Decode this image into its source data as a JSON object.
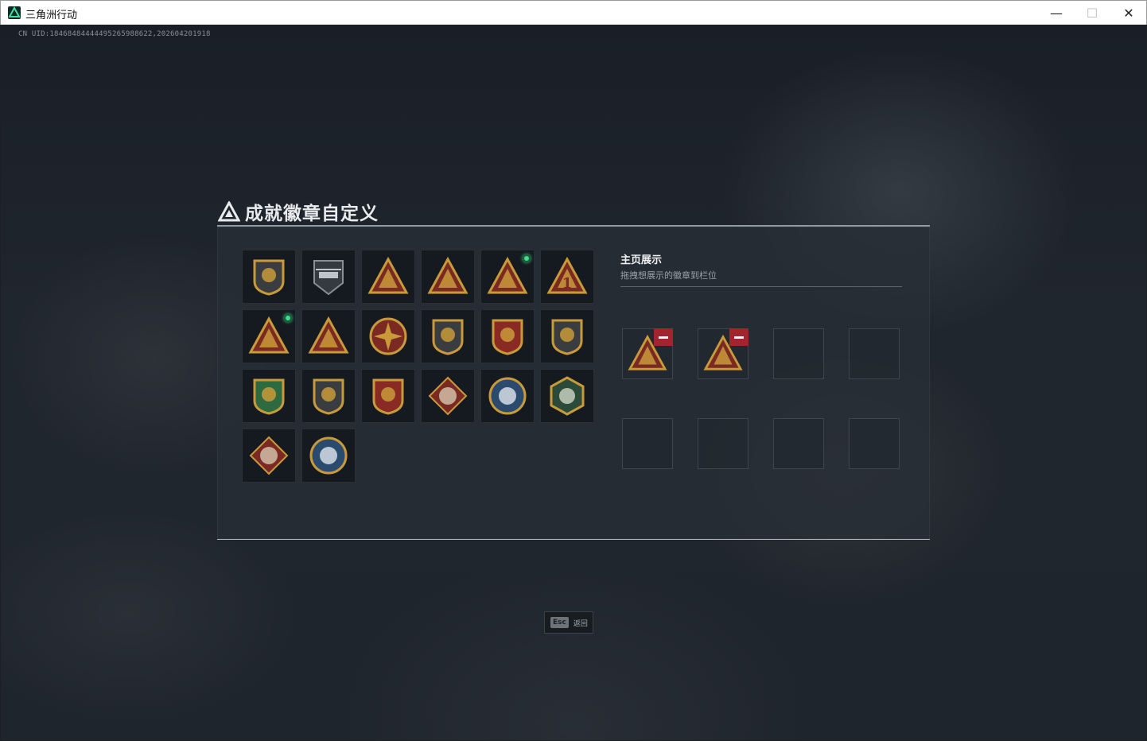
{
  "window": {
    "title": "三角洲行动",
    "minimize": "—",
    "maximize": "☐",
    "close": "✕"
  },
  "uid": "CN UID:18468484444495265988622,202604201918",
  "panel": {
    "title": "成就徽章自定义"
  },
  "showcase": {
    "title": "主页展示",
    "subtitle": "拖拽想展示的徽章到栏位"
  },
  "badges": [
    {
      "icon": "delta-shield-badge-icon",
      "new": false
    },
    {
      "icon": "helicopter-badge-icon",
      "new": false
    },
    {
      "icon": "gold-triangle-tower-badge-icon",
      "new": false
    },
    {
      "icon": "gold-triangle-crate-badge-icon",
      "new": false
    },
    {
      "icon": "gold-triangle-hands-badge-icon",
      "new": true
    },
    {
      "icon": "gold-triangle-number-one-badge-icon",
      "new": false
    },
    {
      "icon": "gold-triangle-helmet-badge-icon",
      "new": true
    },
    {
      "icon": "gold-triangle-soldiers-badge-icon",
      "new": false
    },
    {
      "icon": "star-compass-medal-icon",
      "new": false
    },
    {
      "icon": "shield-emblem-badge-icon",
      "new": false
    },
    {
      "icon": "five-star-crest-badge-icon",
      "new": false
    },
    {
      "icon": "lion-shield-badge-icon",
      "new": false
    },
    {
      "icon": "green-crosshair-shield-badge-icon",
      "new": false
    },
    {
      "icon": "rifle-shield-badge-icon",
      "new": false
    },
    {
      "icon": "crossed-weapons-crest-badge-icon",
      "new": false
    },
    {
      "icon": "red-wolf-diamond-badge-icon",
      "new": false
    },
    {
      "icon": "blue-eagle-round-badge-icon",
      "new": false
    },
    {
      "icon": "green-hawk-hexagon-badge-icon",
      "new": false
    },
    {
      "icon": "red-dragon-diamond-badge-icon",
      "new": false
    },
    {
      "icon": "blue-wolf-round-badge-icon",
      "new": false
    }
  ],
  "slots": [
    {
      "filled": true,
      "icon": "gold-triangle-helmet-badge-icon"
    },
    {
      "filled": true,
      "icon": "gold-triangle-hands-badge-icon"
    },
    {
      "filled": false
    },
    {
      "filled": false
    },
    {
      "filled": false
    },
    {
      "filled": false
    },
    {
      "filled": false
    },
    {
      "filled": false
    }
  ],
  "esc": {
    "key": "Esc",
    "label": "返回"
  },
  "colors": {
    "gold": "#c99a3a",
    "dark_red": "#7a2a22",
    "new_dot": "#3fe08a",
    "remove": "#a3242c"
  }
}
